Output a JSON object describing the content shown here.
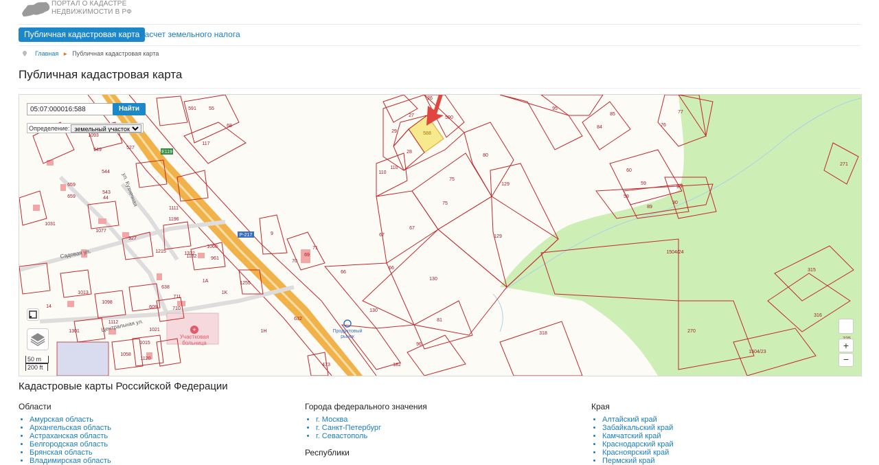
{
  "header": {
    "logo_line1": "ПОРТАЛ О КАДАСТРЕ",
    "logo_line2": "НЕДВИЖИМОСТИ В РФ"
  },
  "nav": {
    "active": "Публичная кадастровая карта",
    "tax": "Расчет земельного налога"
  },
  "breadcrumb": {
    "home": "Главная",
    "current": "Публичная кадастровая карта"
  },
  "page_title": "Публичная кадастровая карта",
  "map": {
    "search_value": "05:07:000016:588",
    "search_button": "Найти",
    "definition_label": "Определение:",
    "definition_value": "земельный участок",
    "scale_m": "50 m",
    "scale_ft": "200 ft",
    "zoom_in": "+",
    "zoom_out": "−",
    "highlight_color": "#f7e98e",
    "parcel_color": "#c0282d",
    "road_color": "#f2b24a",
    "green_color": "#cdeeb5",
    "road_labels": [
      "E119",
      "P-217"
    ],
    "street_labels": [
      "Садовая ул.",
      "Центральная ул.",
      "ул. Кузнечная"
    ],
    "place_labels": [
      "Участковая больница",
      "Продуктовый рынок"
    ],
    "parcel_labels": [
      "591",
      "55",
      "26",
      "590",
      "27",
      "588",
      "29",
      "28",
      "117",
      "68",
      "110",
      "110",
      "75",
      "75",
      "80",
      "129",
      "67",
      "129",
      "67",
      "66",
      "66",
      "130",
      "130",
      "81",
      "96",
      "318",
      "95",
      "85",
      "84",
      "76",
      "77",
      "271",
      "60",
      "59",
      "59",
      "90",
      "90",
      "89",
      "1504/24",
      "315",
      "316",
      "270",
      "1504/23",
      "225",
      "1093",
      "949",
      "527",
      "544",
      "543",
      "659",
      "659",
      "44",
      "1077",
      "1111",
      "1196",
      "1031",
      "927",
      "1060",
      "961",
      "1132",
      "1215",
      "638",
      "711",
      "710",
      "609",
      "1098",
      "1112",
      "1021",
      "1015",
      "1058",
      "1120",
      "1301",
      "1255",
      "9",
      "71",
      "69",
      "70",
      "632",
      "473",
      "1332",
      "1013",
      "182",
      "1H",
      "1A",
      "1K",
      "14"
    ]
  },
  "section": {
    "title": "Кадастровые карты Российской Федерации",
    "regions_title": "Области",
    "regions": [
      "Амурская область",
      "Архангельская область",
      "Астраханская область",
      "Белгородская область",
      "Брянская область",
      "Владимирская область"
    ],
    "cities_title": "Города федерального значения",
    "cities": [
      "г. Москва",
      "г. Санкт-Петербург",
      "г. Севастополь"
    ],
    "republics_title": "Республики",
    "krai_title": "Края",
    "krai": [
      "Алтайский край",
      "Забайкальский край",
      "Камчатский край",
      "Краснодарский край",
      "Красноярский край",
      "Пермский край"
    ]
  }
}
